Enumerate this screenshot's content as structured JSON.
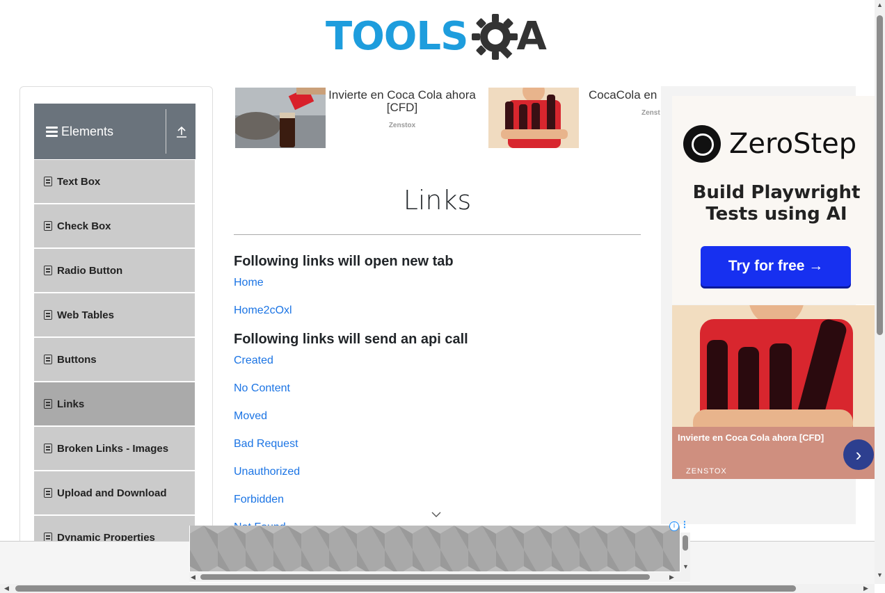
{
  "logo": {
    "text_main": "TOOLS",
    "text_end": "A"
  },
  "sidebar": {
    "group_title": "Elements",
    "items": [
      {
        "label": "Text Box",
        "active": false
      },
      {
        "label": "Check Box",
        "active": false
      },
      {
        "label": "Radio Button",
        "active": false
      },
      {
        "label": "Web Tables",
        "active": false
      },
      {
        "label": "Buttons",
        "active": false
      },
      {
        "label": "Links",
        "active": true
      },
      {
        "label": "Broken Links - Images",
        "active": false
      },
      {
        "label": "Upload and Download",
        "active": false
      },
      {
        "label": "Dynamic Properties",
        "active": false
      }
    ]
  },
  "top_ads": [
    {
      "title": "Invierte en Coca Cola ahora [CFD]",
      "source": "Zenstox"
    },
    {
      "title": "CocaCola en [CF",
      "source": "Zenst"
    }
  ],
  "main": {
    "title": "Links",
    "section_new_tab": "Following links will open new tab",
    "new_tab_links": [
      "Home",
      "Home2cOxl"
    ],
    "section_api": "Following links will send an api call",
    "api_links": [
      "Created",
      "No Content",
      "Moved",
      "Bad Request",
      "Unauthorized",
      "Forbidden",
      "Not Found"
    ]
  },
  "right_ad": {
    "brand": "ZeroStep",
    "headline": "Build Playwright Tests using AI",
    "cta": "Try for free →",
    "caption": "Invierte en Coca Cola ahora [CFD]",
    "caption_source": "ZENSTOX"
  },
  "colors": {
    "accent_link": "#1b74e4",
    "sidebar_header": "#6a737c",
    "sidebar_item": "#cbcbcb",
    "sidebar_active": "#aaaaaa",
    "cta_blue": "#1730f0",
    "logo_blue": "#1e9ddd"
  }
}
